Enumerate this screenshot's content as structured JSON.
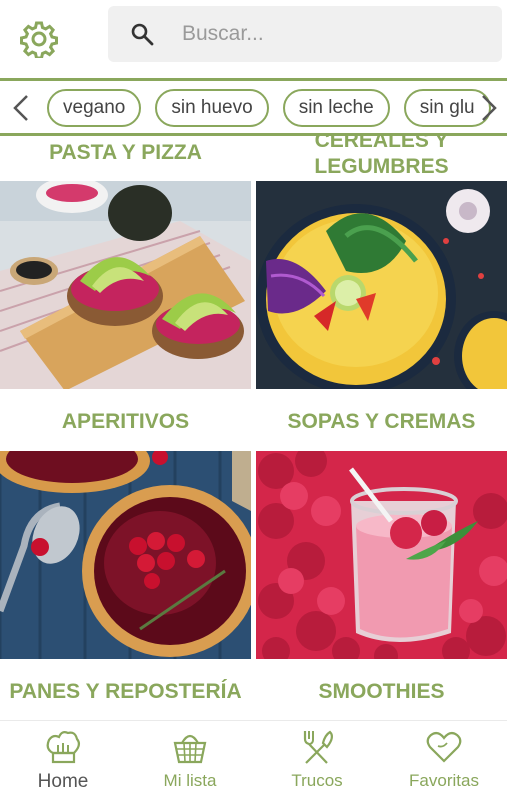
{
  "header": {
    "settings_icon": "gear-icon",
    "search": {
      "placeholder": "Buscar...",
      "value": "",
      "icon": "search-icon"
    }
  },
  "filters": {
    "chips": [
      "vegano",
      "sin huevo",
      "sin leche",
      "sin glu"
    ],
    "left_icon": "chevron-left-icon",
    "right_icon": "chevron-right-icon"
  },
  "categories": [
    {
      "title": "PASTA Y PIZZA"
    },
    {
      "title": "CEREALES Y LEGUMBRES"
    },
    {
      "title": "APERITIVOS"
    },
    {
      "title": "SOPAS Y CREMAS"
    },
    {
      "title": "PANES Y REPOSTERÍA"
    },
    {
      "title": "SMOOTHIES"
    }
  ],
  "nav": {
    "items": [
      {
        "label": "Home",
        "icon": "chef-hat-icon",
        "active": true
      },
      {
        "label": "Mi lista",
        "icon": "basket-icon",
        "active": false
      },
      {
        "label": "Trucos",
        "icon": "utensils-icon",
        "active": false
      },
      {
        "label": "Favoritas",
        "icon": "heart-icon",
        "active": false
      }
    ]
  },
  "colors": {
    "accent": "#8aa75c",
    "search_bg": "#f0f0f0"
  }
}
